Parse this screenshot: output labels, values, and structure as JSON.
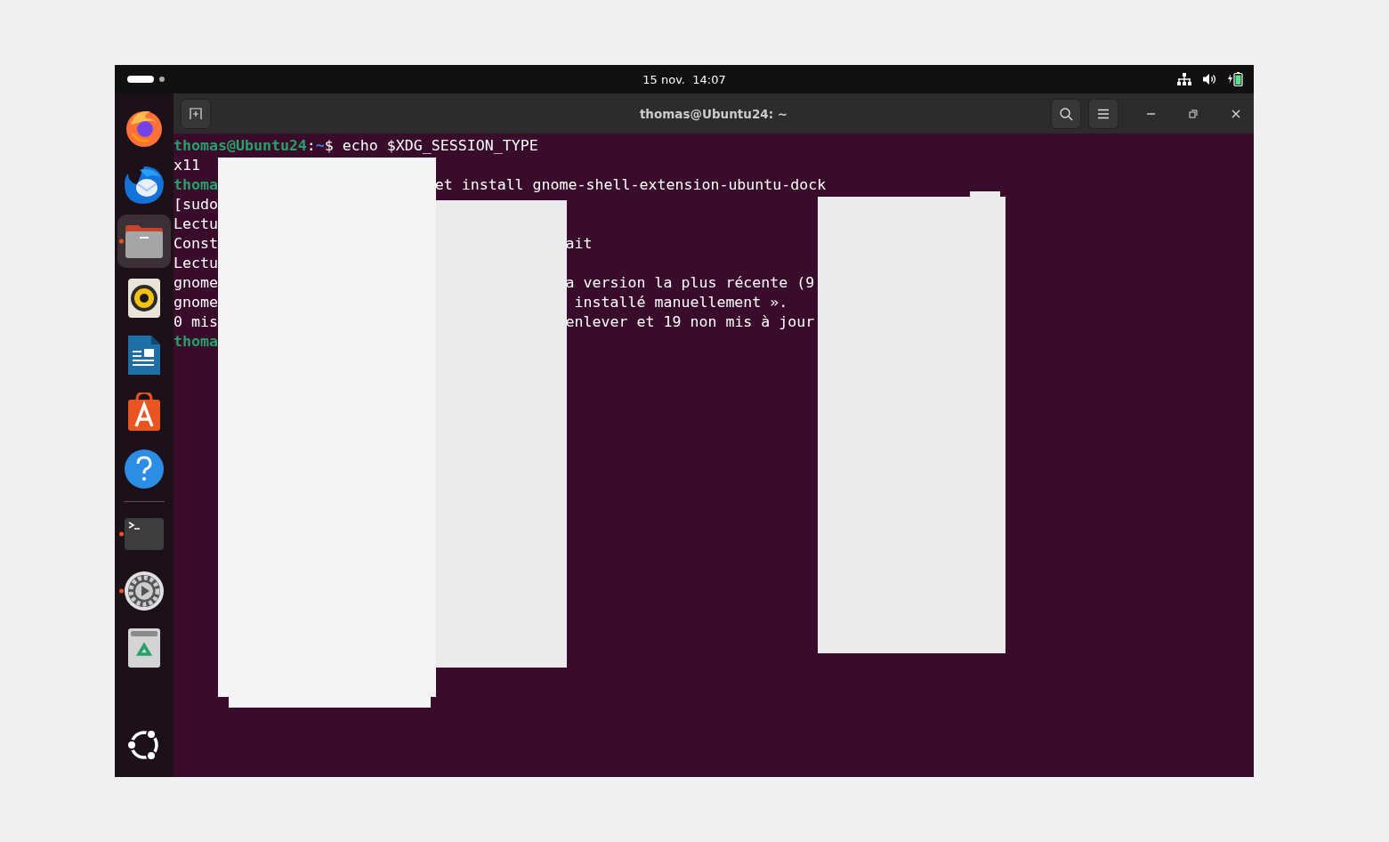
{
  "top_bar": {
    "clock": "15 nov.  14:07"
  },
  "dock": {
    "items": [
      {
        "kind": "firefox",
        "running": false,
        "selected": false
      },
      {
        "kind": "thunderbird",
        "running": false,
        "selected": false
      },
      {
        "kind": "files",
        "running": true,
        "selected": true
      },
      {
        "kind": "rhythmbox",
        "running": false,
        "selected": false
      },
      {
        "kind": "writer",
        "running": false,
        "selected": false
      },
      {
        "kind": "appcenter",
        "running": false,
        "selected": false
      },
      {
        "kind": "help",
        "running": false,
        "selected": false
      },
      {
        "kind": "separator"
      },
      {
        "kind": "terminal",
        "running": true,
        "selected": false
      },
      {
        "kind": "settings",
        "running": true,
        "selected": false
      },
      {
        "kind": "trash",
        "running": false,
        "selected": false
      }
    ]
  },
  "window": {
    "title": "thomas@Ubuntu24: ~"
  },
  "terminal": {
    "lines": [
      {
        "parts": [
          {
            "kind": "user",
            "text": "thomas@Ubuntu24"
          },
          {
            "kind": "plain",
            "text": ":"
          },
          {
            "kind": "path",
            "text": "~"
          },
          {
            "kind": "plain",
            "text": "$ echo $XDG_SESSION_TYPE"
          }
        ]
      },
      {
        "parts": [
          {
            "kind": "plain",
            "text": "x11"
          }
        ]
      },
      {
        "parts": [
          {
            "kind": "user",
            "text": "thoma"
          }
        ],
        "tail": "et install gnome-shell-extension-ubuntu-dock"
      },
      {
        "parts": [
          {
            "kind": "plain",
            "text": "[sudo"
          }
        ]
      },
      {
        "parts": [
          {
            "kind": "plain",
            "text": "Lectu"
          }
        ]
      },
      {
        "parts": [
          {
            "kind": "plain",
            "text": "Const"
          }
        ],
        "tail": "ait"
      },
      {
        "parts": [
          {
            "kind": "plain",
            "text": "Lectu"
          }
        ]
      },
      {
        "parts": [
          {
            "kind": "plain",
            "text": "gnome"
          }
        ],
        "tail": "a version la plus récente (9"
      },
      {
        "parts": [
          {
            "kind": "plain",
            "text": "gnome"
          }
        ],
        "tail": "installé manuellement »."
      },
      {
        "parts": [
          {
            "kind": "plain",
            "text": "0 mis"
          }
        ],
        "tail": "enlever et 19 non mis à jour"
      },
      {
        "parts": [
          {
            "kind": "user",
            "text": "thoma"
          }
        ]
      }
    ]
  }
}
